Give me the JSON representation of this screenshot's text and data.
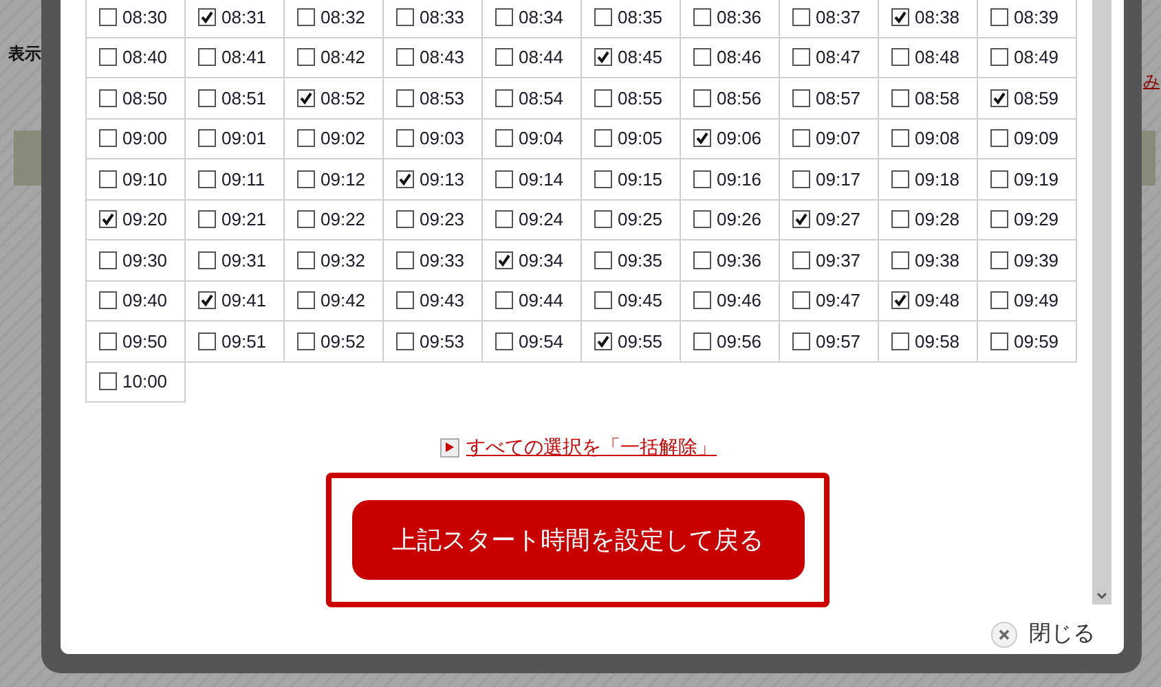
{
  "background": {
    "heading": "表示",
    "link": "み"
  },
  "slots": [
    {
      "time": "08:30",
      "checked": false
    },
    {
      "time": "08:31",
      "checked": true
    },
    {
      "time": "08:32",
      "checked": false
    },
    {
      "time": "08:33",
      "checked": false
    },
    {
      "time": "08:34",
      "checked": false
    },
    {
      "time": "08:35",
      "checked": false
    },
    {
      "time": "08:36",
      "checked": false
    },
    {
      "time": "08:37",
      "checked": false
    },
    {
      "time": "08:38",
      "checked": true
    },
    {
      "time": "08:39",
      "checked": false
    },
    {
      "time": "08:40",
      "checked": false
    },
    {
      "time": "08:41",
      "checked": false
    },
    {
      "time": "08:42",
      "checked": false
    },
    {
      "time": "08:43",
      "checked": false
    },
    {
      "time": "08:44",
      "checked": false
    },
    {
      "time": "08:45",
      "checked": true
    },
    {
      "time": "08:46",
      "checked": false
    },
    {
      "time": "08:47",
      "checked": false
    },
    {
      "time": "08:48",
      "checked": false
    },
    {
      "time": "08:49",
      "checked": false
    },
    {
      "time": "08:50",
      "checked": false
    },
    {
      "time": "08:51",
      "checked": false
    },
    {
      "time": "08:52",
      "checked": true
    },
    {
      "time": "08:53",
      "checked": false
    },
    {
      "time": "08:54",
      "checked": false
    },
    {
      "time": "08:55",
      "checked": false
    },
    {
      "time": "08:56",
      "checked": false
    },
    {
      "time": "08:57",
      "checked": false
    },
    {
      "time": "08:58",
      "checked": false
    },
    {
      "time": "08:59",
      "checked": true
    },
    {
      "time": "09:00",
      "checked": false
    },
    {
      "time": "09:01",
      "checked": false
    },
    {
      "time": "09:02",
      "checked": false
    },
    {
      "time": "09:03",
      "checked": false
    },
    {
      "time": "09:04",
      "checked": false
    },
    {
      "time": "09:05",
      "checked": false
    },
    {
      "time": "09:06",
      "checked": true
    },
    {
      "time": "09:07",
      "checked": false
    },
    {
      "time": "09:08",
      "checked": false
    },
    {
      "time": "09:09",
      "checked": false
    },
    {
      "time": "09:10",
      "checked": false
    },
    {
      "time": "09:11",
      "checked": false
    },
    {
      "time": "09:12",
      "checked": false
    },
    {
      "time": "09:13",
      "checked": true
    },
    {
      "time": "09:14",
      "checked": false
    },
    {
      "time": "09:15",
      "checked": false
    },
    {
      "time": "09:16",
      "checked": false
    },
    {
      "time": "09:17",
      "checked": false
    },
    {
      "time": "09:18",
      "checked": false
    },
    {
      "time": "09:19",
      "checked": false
    },
    {
      "time": "09:20",
      "checked": true
    },
    {
      "time": "09:21",
      "checked": false
    },
    {
      "time": "09:22",
      "checked": false
    },
    {
      "time": "09:23",
      "checked": false
    },
    {
      "time": "09:24",
      "checked": false
    },
    {
      "time": "09:25",
      "checked": false
    },
    {
      "time": "09:26",
      "checked": false
    },
    {
      "time": "09:27",
      "checked": true
    },
    {
      "time": "09:28",
      "checked": false
    },
    {
      "time": "09:29",
      "checked": false
    },
    {
      "time": "09:30",
      "checked": false
    },
    {
      "time": "09:31",
      "checked": false
    },
    {
      "time": "09:32",
      "checked": false
    },
    {
      "time": "09:33",
      "checked": false
    },
    {
      "time": "09:34",
      "checked": true
    },
    {
      "time": "09:35",
      "checked": false
    },
    {
      "time": "09:36",
      "checked": false
    },
    {
      "time": "09:37",
      "checked": false
    },
    {
      "time": "09:38",
      "checked": false
    },
    {
      "time": "09:39",
      "checked": false
    },
    {
      "time": "09:40",
      "checked": false
    },
    {
      "time": "09:41",
      "checked": true
    },
    {
      "time": "09:42",
      "checked": false
    },
    {
      "time": "09:43",
      "checked": false
    },
    {
      "time": "09:44",
      "checked": false
    },
    {
      "time": "09:45",
      "checked": false
    },
    {
      "time": "09:46",
      "checked": false
    },
    {
      "time": "09:47",
      "checked": false
    },
    {
      "time": "09:48",
      "checked": true
    },
    {
      "time": "09:49",
      "checked": false
    },
    {
      "time": "09:50",
      "checked": false
    },
    {
      "time": "09:51",
      "checked": false
    },
    {
      "time": "09:52",
      "checked": false
    },
    {
      "time": "09:53",
      "checked": false
    },
    {
      "time": "09:54",
      "checked": false
    },
    {
      "time": "09:55",
      "checked": true
    },
    {
      "time": "09:56",
      "checked": false
    },
    {
      "time": "09:57",
      "checked": false
    },
    {
      "time": "09:58",
      "checked": false
    },
    {
      "time": "09:59",
      "checked": false
    },
    {
      "time": "10:00",
      "checked": false
    }
  ],
  "clear_link": "すべての選択を「一括解除」",
  "submit_button": "上記スタート時間を設定して戻る",
  "close_button": "閉じる"
}
